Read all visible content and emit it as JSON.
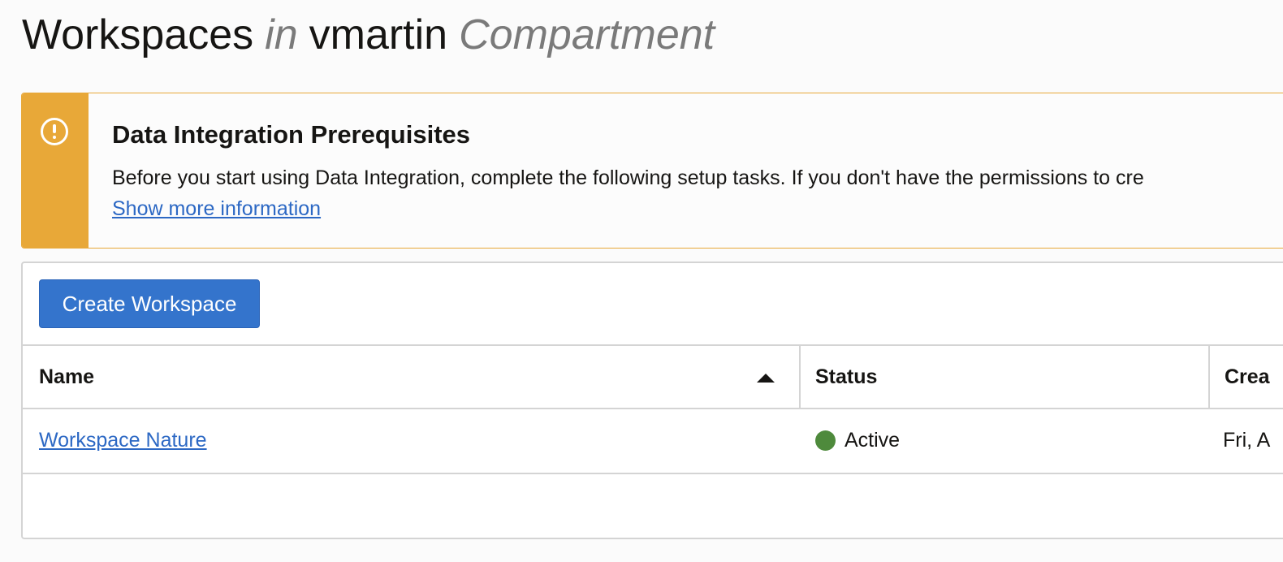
{
  "header": {
    "title_word": "Workspaces",
    "title_in": "in",
    "compartment_name": "vmartin",
    "compartment_label": "Compartment"
  },
  "alert": {
    "type": "warning",
    "title": "Data Integration Prerequisites",
    "body": "Before you start using Data Integration, complete the following setup tasks. If you don't have the permissions to cre",
    "link": "Show more information"
  },
  "toolbar": {
    "create_label": "Create Workspace"
  },
  "table": {
    "columns": [
      {
        "label": "Name",
        "sort": "ascending"
      },
      {
        "label": "Status"
      },
      {
        "label": "Crea"
      }
    ],
    "rows": [
      {
        "name": "Workspace Nature",
        "status": "Active",
        "created": "Fri, A"
      }
    ]
  },
  "colors": {
    "accent": "#3474cc",
    "warning": "#e8a838",
    "status_active": "#4e8a3c",
    "link": "#2c68c4"
  }
}
